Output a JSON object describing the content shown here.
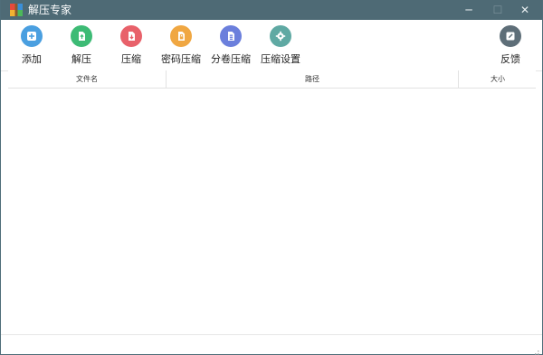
{
  "window": {
    "title": "解压专家",
    "app_icon": "winrar-stack-icon"
  },
  "title_buttons": {
    "minimize": "─",
    "maximize": "☐",
    "close": "✕"
  },
  "toolbar": {
    "items": [
      {
        "label": "添加",
        "icon": "add-icon",
        "color": "#4a9fe0"
      },
      {
        "label": "解压",
        "icon": "extract-icon",
        "color": "#3dbb75"
      },
      {
        "label": "压缩",
        "icon": "compress-icon",
        "color": "#e8616a"
      },
      {
        "label": "密码压缩",
        "icon": "password-compress-icon",
        "color": "#f0a742"
      },
      {
        "label": "分卷压缩",
        "icon": "split-compress-icon",
        "color": "#6b7fdc"
      },
      {
        "label": "压缩设置",
        "icon": "settings-icon",
        "color": "#5fa9a3"
      }
    ],
    "feedback": {
      "label": "反馈",
      "icon": "feedback-icon",
      "color": "#5e6e78"
    }
  },
  "columns": {
    "name": "文件名",
    "path": "路径",
    "size": "大小"
  },
  "colors": {
    "titlebar": "#4e6a75",
    "background": "#ffffff"
  }
}
